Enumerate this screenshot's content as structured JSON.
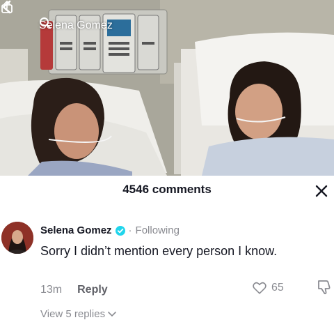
{
  "header": {
    "search_text": "Selena Gomez"
  },
  "comments_panel": {
    "count_label": "4546 comments"
  },
  "comment": {
    "username": "Selena Gomez",
    "separator": "·",
    "relationship": "Following",
    "text": "Sorry I didn’t mention every person I know.",
    "time": "13m",
    "reply_label": "Reply",
    "likes": "65",
    "view_replies": "View 5 replies"
  },
  "colors": {
    "verified": "#20d5ec",
    "muted_text": "#8a8b91",
    "primary_text": "#161823"
  }
}
